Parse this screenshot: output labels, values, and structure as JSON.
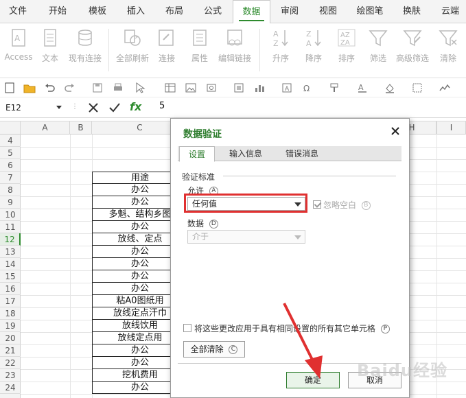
{
  "menu": {
    "tabs": [
      "文件",
      "开始",
      "模板",
      "插入",
      "布局",
      "公式",
      "数据",
      "审阅",
      "视图",
      "绘图笔",
      "换肤",
      "云端"
    ],
    "active": "数据"
  },
  "ribbon": {
    "buttons": [
      "Access",
      "文本",
      "现有连接",
      "全部刷新",
      "连接",
      "属性",
      "编辑链接",
      "升序",
      "降序",
      "排序",
      "筛选",
      "高级筛选",
      "清除"
    ]
  },
  "formula_bar": {
    "name_box": "E12",
    "fx": "fx",
    "value": "5"
  },
  "grid": {
    "columns": [
      "A",
      "B",
      "C",
      "H",
      "I"
    ],
    "rows": [
      "4",
      "5",
      "6",
      "7",
      "8",
      "9",
      "10",
      "11",
      "12",
      "13",
      "14",
      "15",
      "16",
      "17",
      "18",
      "19",
      "20",
      "21",
      "22",
      "23",
      "24"
    ],
    "selected_row": "12",
    "c_cells": [
      "用途",
      "办公",
      "办公",
      "多魁、结构乡图",
      "办公",
      "放线、定点",
      "办公",
      "办公",
      "办公",
      "办公",
      "粘A0图纸用",
      "放线定点汗巾",
      "放线饮用",
      "放线定点用",
      "办公",
      "办公",
      "挖机费用",
      "办公"
    ]
  },
  "dialog": {
    "title": "数据验证",
    "tabs": [
      "设置",
      "输入信息",
      "错误消息"
    ],
    "active_tab": "设置",
    "criteria_label": "验证标准",
    "allow_label": "允许",
    "allow_key": "A",
    "allow_value": "任何值",
    "ignore_blank_label": "忽略空白",
    "ignore_blank_key": "B",
    "data_label": "数据",
    "data_key": "D",
    "data_value": "介于",
    "apply_all_label": "将这些更改应用于具有相同设置的所有其它单元格",
    "apply_all_key": "P",
    "clear_all_label": "全部清除",
    "clear_all_key": "C",
    "ok_label": "确定",
    "cancel_label": "取消"
  },
  "colors": {
    "accent": "#2e7d2e",
    "highlight": "#e03030"
  },
  "watermark": "Baidu经验"
}
